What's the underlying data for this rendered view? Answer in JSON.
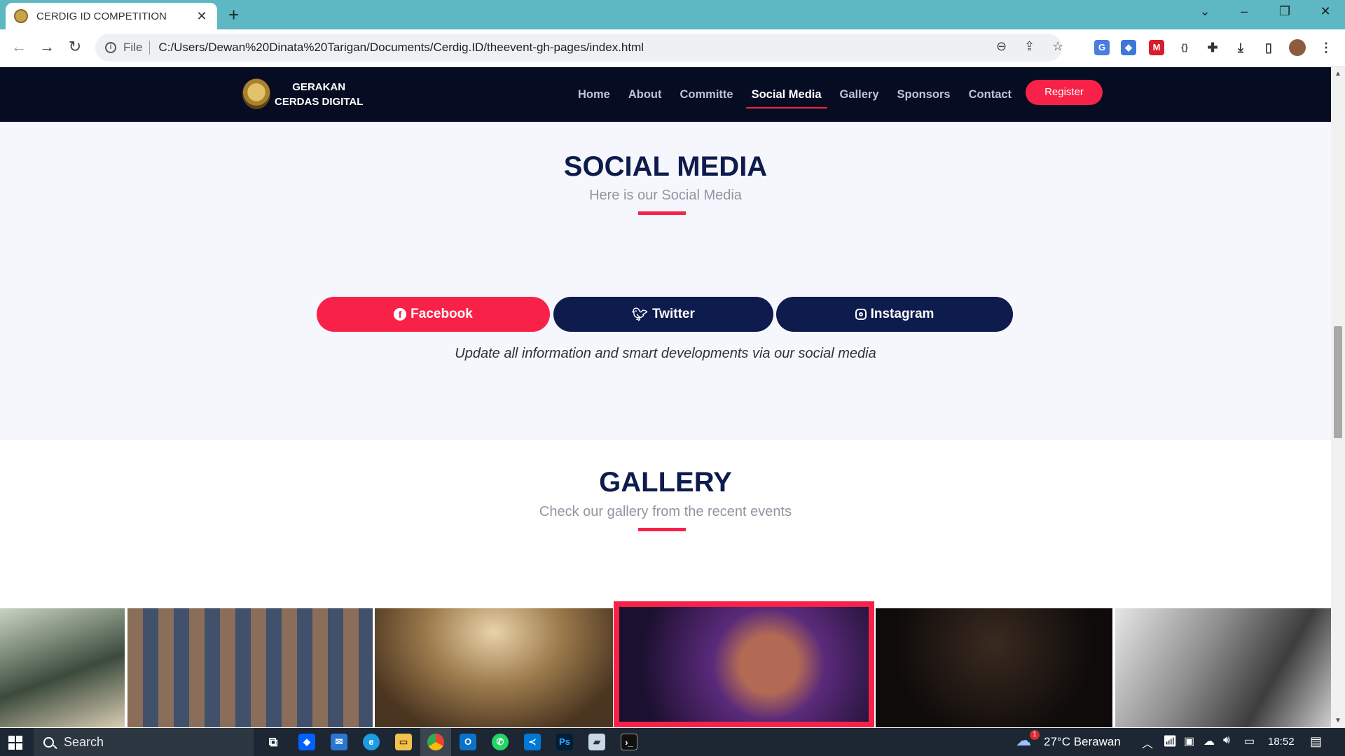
{
  "browser": {
    "tab_title": "CERDIG ID COMPETITION",
    "tab_close": "✕",
    "new_tab": "+",
    "omnibox_scheme": "File",
    "url": "C:/Users/Dewan%20Dinata%20Tarigan/Documents/Cerdig.ID/theevent-gh-pages/index.html",
    "icons": [
      "back-arrow-icon",
      "forward-arrow-icon",
      "reload-icon",
      "info-icon",
      "zoom-out-icon",
      "share-icon",
      "star-icon",
      "translate-extension-icon",
      "extension-icon",
      "mendeley-extension-icon",
      "json-extension-icon",
      "puzzle-icon",
      "download-icon",
      "side-panel-icon",
      "profile-avatar",
      "kebab-menu-icon"
    ]
  },
  "site": {
    "logo_line1": "GERAKAN",
    "logo_line2": "CERDAS DIGITAL",
    "nav": [
      {
        "label": "Home"
      },
      {
        "label": "About"
      },
      {
        "label": "Committe"
      },
      {
        "label": "Social Media",
        "active": true
      },
      {
        "label": "Gallery"
      },
      {
        "label": "Sponsors"
      },
      {
        "label": "Contact"
      }
    ],
    "register": "Register",
    "accent_color": "#f82249",
    "navy_color": "#0e1b4d"
  },
  "social": {
    "title": "SOCIAL MEDIA",
    "subtitle": "Here is our Social Media",
    "buttons": [
      {
        "label": "Facebook",
        "icon": "facebook-icon",
        "color": "#f82249"
      },
      {
        "label": "Twitter",
        "icon": "twitter-icon",
        "color": "#0e1b4d"
      },
      {
        "label": "Instagram",
        "icon": "instagram-icon",
        "color": "#0e1b4d"
      }
    ],
    "note": "Update all information and smart developments via our social media"
  },
  "gallery": {
    "title": "GALLERY",
    "subtitle": "Check our gallery from the recent events",
    "photos": [
      "speaker-photo",
      "audience-photo",
      "hall-photo",
      "attendee-laptop-photo",
      "concert-crowd-photo",
      "meeting-photo"
    ]
  },
  "taskbar": {
    "search_placeholder": "Search",
    "weather_badge": "1",
    "weather": "27°C  Berawan",
    "time": "18:52"
  }
}
